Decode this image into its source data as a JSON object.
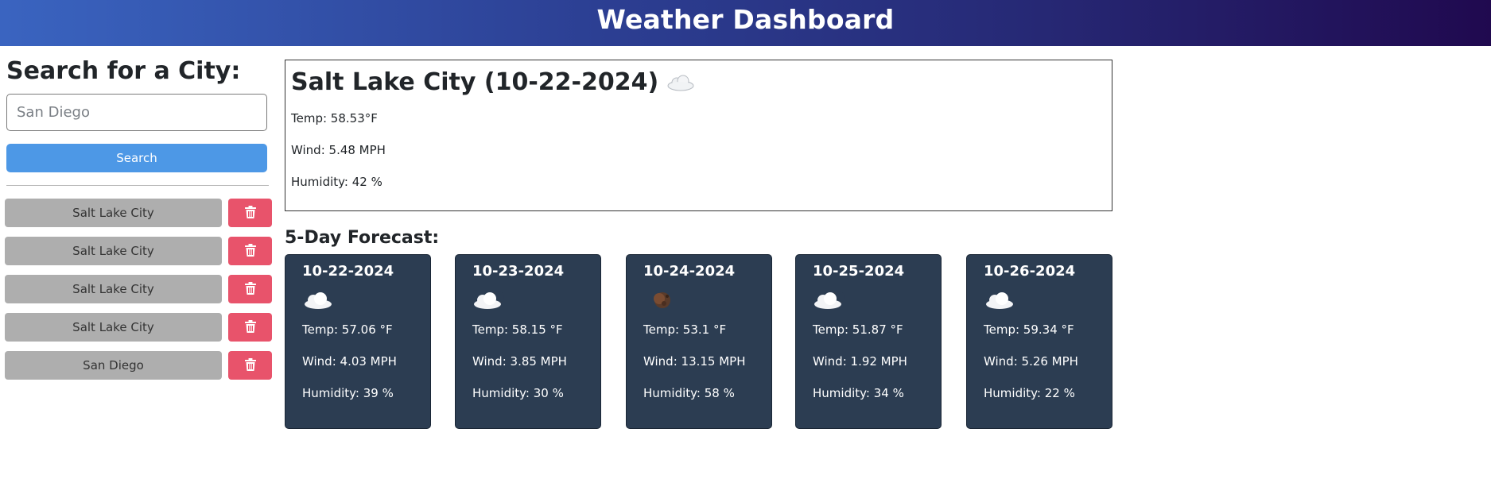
{
  "header": {
    "title": "Weather Dashboard"
  },
  "search": {
    "heading": "Search for a City:",
    "input_value": "",
    "placeholder": "San Diego",
    "button_label": "Search"
  },
  "history": [
    {
      "city": "Salt Lake City"
    },
    {
      "city": "Salt Lake City"
    },
    {
      "city": "Salt Lake City"
    },
    {
      "city": "Salt Lake City"
    },
    {
      "city": "San Diego"
    }
  ],
  "current": {
    "title": "Salt Lake City (10-22-2024)",
    "icon": "cloud-icon",
    "temp": "Temp: 58.53°F",
    "wind": "Wind: 5.48 MPH",
    "humidity": "Humidity: 42 %"
  },
  "forecast": {
    "heading": "5-Day Forecast:",
    "days": [
      {
        "date": "10-22-2024",
        "icon": "cloud-icon",
        "temp": "Temp: 57.06 °F",
        "wind": "Wind: 4.03 MPH",
        "humidity": "Humidity: 39 %"
      },
      {
        "date": "10-23-2024",
        "icon": "cloud-night-icon",
        "temp": "Temp: 58.15 °F",
        "wind": "Wind: 3.85 MPH",
        "humidity": "Humidity: 30 %"
      },
      {
        "date": "10-24-2024",
        "icon": "moon-icon",
        "temp": "Temp: 53.1 °F",
        "wind": "Wind: 13.15 MPH",
        "humidity": "Humidity: 58 %"
      },
      {
        "date": "10-25-2024",
        "icon": "cloud-night-icon",
        "temp": "Temp: 51.87 °F",
        "wind": "Wind: 1.92 MPH",
        "humidity": "Humidity: 34 %"
      },
      {
        "date": "10-26-2024",
        "icon": "cloud-icon",
        "temp": "Temp: 59.34 °F",
        "wind": "Wind: 5.26 MPH",
        "humidity": "Humidity: 22 %"
      }
    ]
  },
  "colors": {
    "header_start": "#3a64c0",
    "header_end": "#20094f",
    "search_button": "#4d98e6",
    "history_button": "#aeaeae",
    "delete_button": "#e8536b",
    "forecast_card": "#2c3d52"
  }
}
